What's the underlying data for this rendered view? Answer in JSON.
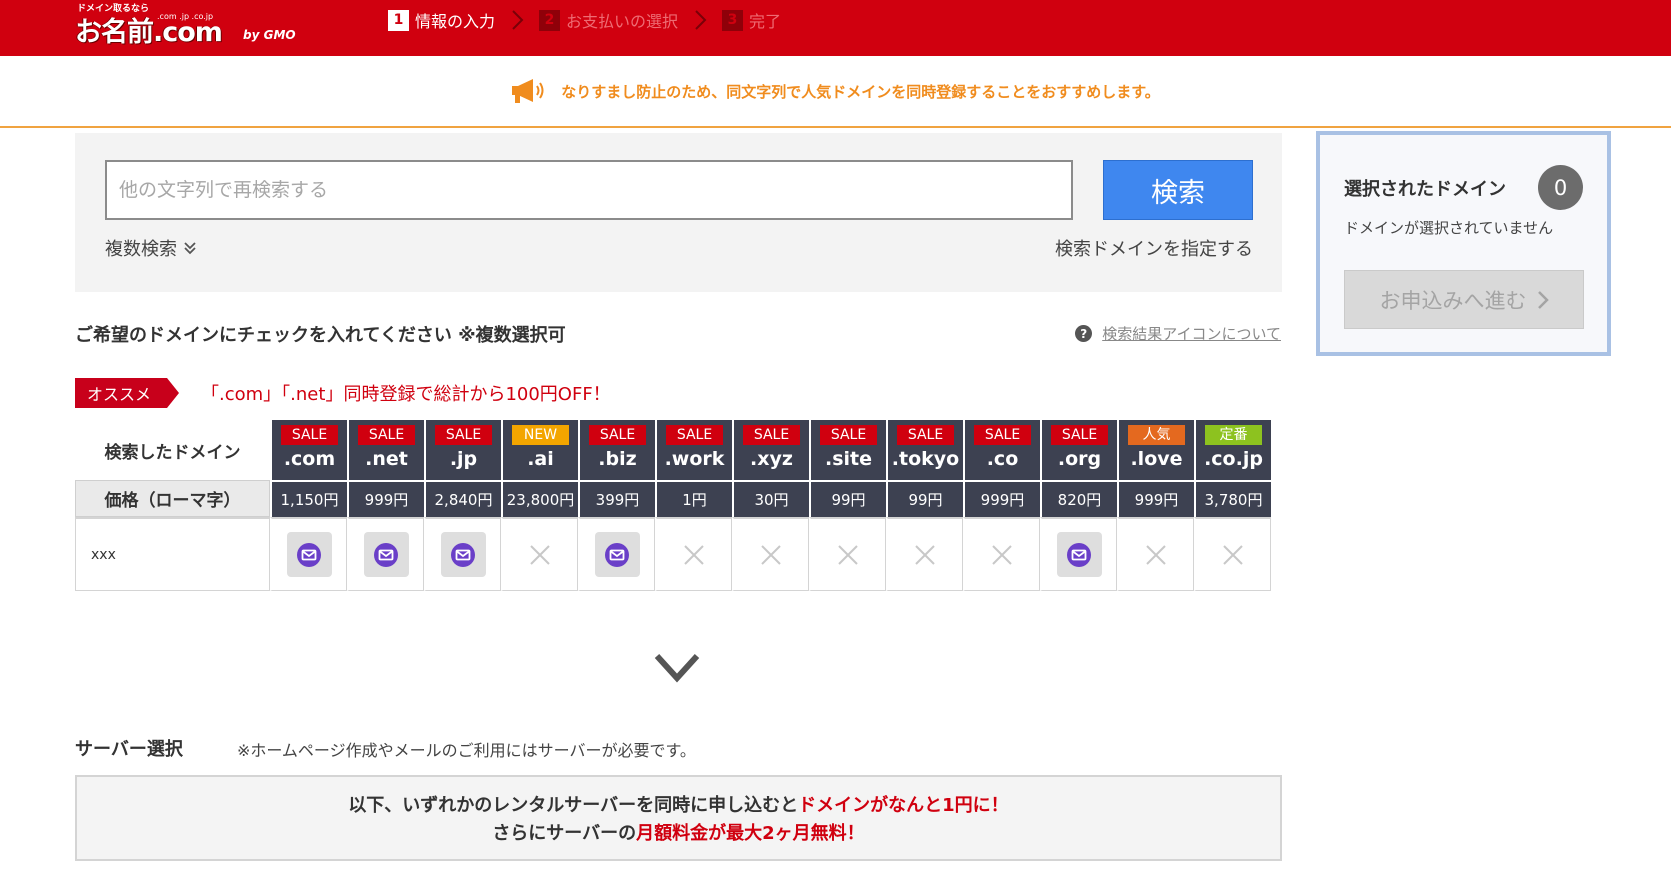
{
  "header": {
    "logo": {
      "tagline": "ドメイン取るなら",
      "brand": "お名前.com",
      "tlds": ".com .jp .co.jp",
      "company": "by GMO"
    },
    "steps": [
      {
        "num": "1",
        "label": "情報の入力",
        "state": "active"
      },
      {
        "num": "2",
        "label": "お支払いの選択",
        "state": "inactive"
      },
      {
        "num": "3",
        "label": "完了",
        "state": "inactive"
      }
    ]
  },
  "notice": {
    "icon": "megaphone-icon",
    "text": "なりすまし防止のため、同文字列で人気ドメインを同時登録することをおすすめします。"
  },
  "search": {
    "placeholder": "他の文字列で再検索する",
    "value": "",
    "button_label": "検索",
    "multi_search_label": "複数検索",
    "specify_domain_label": "検索ドメインを指定する"
  },
  "selected_panel": {
    "title": "選択されたドメイン",
    "count": "0",
    "empty_text": "ドメインが選択されていません",
    "proceed_label": "お申込みへ進む"
  },
  "results": {
    "heading": "ご希望のドメインにチェックを入れてください ※複数選択可",
    "icon_help_label": "検索結果アイコンについて",
    "recommend_tag": "オススメ",
    "recommend_text": "「.com」「.net」同時登録で総計から100円OFF！",
    "searched_domain_label": "検索したドメイン",
    "price_label": "価格（ローマ字）",
    "row_label": "xxx",
    "domains": [
      {
        "badge": "SALE",
        "badge_type": "sale",
        "tld": ".com",
        "price": "1,150円",
        "status": "available"
      },
      {
        "badge": "SALE",
        "badge_type": "sale",
        "tld": ".net",
        "price": "999円",
        "status": "available"
      },
      {
        "badge": "SALE",
        "badge_type": "sale",
        "tld": ".jp",
        "price": "2,840円",
        "status": "available"
      },
      {
        "badge": "NEW",
        "badge_type": "new",
        "tld": ".ai",
        "price": "23,800円",
        "status": "unavailable"
      },
      {
        "badge": "SALE",
        "badge_type": "sale",
        "tld": ".biz",
        "price": "399円",
        "status": "available"
      },
      {
        "badge": "SALE",
        "badge_type": "sale",
        "tld": ".work",
        "price": "1円",
        "status": "unavailable"
      },
      {
        "badge": "SALE",
        "badge_type": "sale",
        "tld": ".xyz",
        "price": "30円",
        "status": "unavailable"
      },
      {
        "badge": "SALE",
        "badge_type": "sale",
        "tld": ".site",
        "price": "99円",
        "status": "unavailable"
      },
      {
        "badge": "SALE",
        "badge_type": "sale",
        "tld": ".tokyo",
        "price": "99円",
        "status": "unavailable"
      },
      {
        "badge": "SALE",
        "badge_type": "sale",
        "tld": ".co",
        "price": "999円",
        "status": "unavailable"
      },
      {
        "badge": "SALE",
        "badge_type": "sale",
        "tld": ".org",
        "price": "820円",
        "status": "available"
      },
      {
        "badge": "人気",
        "badge_type": "pop",
        "tld": ".love",
        "price": "999円",
        "status": "unavailable"
      },
      {
        "badge": "定番",
        "badge_type": "std",
        "tld": ".co.jp",
        "price": "3,780円",
        "status": "unavailable"
      }
    ]
  },
  "server": {
    "title": "サーバー選択",
    "note": "※ホームページ作成やメールのご利用にはサーバーが必要です。",
    "promo_line1_prefix": "以下、いずれかのレンタルサーバーを同時に申し込むと",
    "promo_line1_highlight": "ドメインがなんと1円に！",
    "promo_line2_prefix": "さらにサーバーの",
    "promo_line2_highlight": "月額料金が最大2ヶ月無料！"
  },
  "colors": {
    "header_red": "#d0000f",
    "notice_orange": "#f08c1e",
    "search_blue": "#3f87ef",
    "table_dark": "#3d4151",
    "mail_purple": "#6a3fc8"
  }
}
